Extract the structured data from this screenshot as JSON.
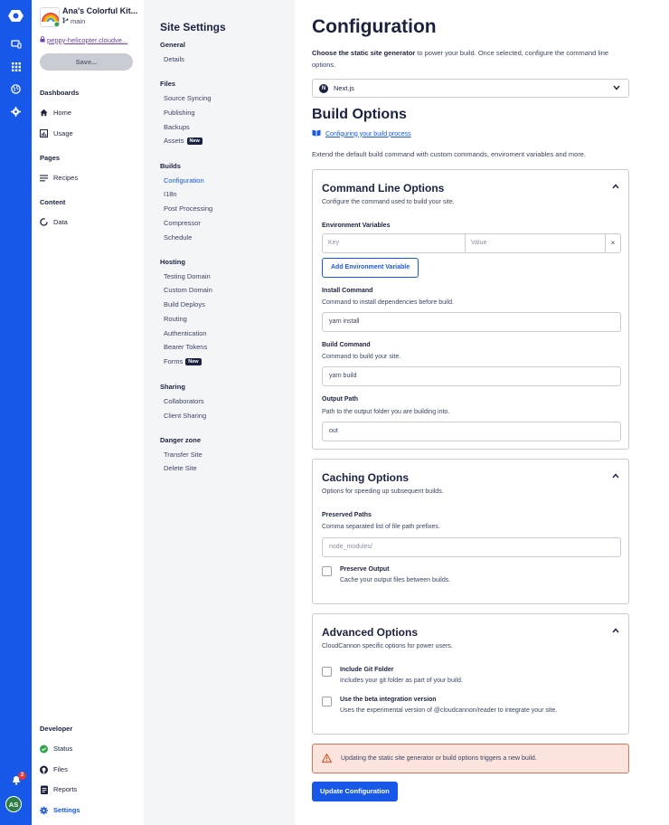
{
  "site": {
    "name": "Ana's Colorful Kit...",
    "branch": "main",
    "url": "peppy-helicopter.cloudve...",
    "save_label": "Save..."
  },
  "rail": {
    "notifications_count": "2",
    "avatar_initials": "AS"
  },
  "nav": {
    "dashboards_heading": "Dashboards",
    "home": "Home",
    "usage": "Usage",
    "pages_heading": "Pages",
    "recipes": "Recipes",
    "content_heading": "Content",
    "data": "Data",
    "developer_heading": "Developer",
    "status": "Status",
    "files": "Files",
    "reports": "Reports",
    "settings": "Settings"
  },
  "settings_nav": {
    "title": "Site Settings",
    "groups": [
      {
        "heading": "General",
        "items": [
          "Details"
        ]
      },
      {
        "heading": "Files",
        "items": [
          "Source Syncing",
          "Publishing",
          "Backups",
          "Assets"
        ]
      },
      {
        "heading": "Builds",
        "items": [
          "Configuration",
          "I18n",
          "Post Processing",
          "Compressor",
          "Schedule"
        ]
      },
      {
        "heading": "Hosting",
        "items": [
          "Testing Domain",
          "Custom Domain",
          "Build Deploys",
          "Routing",
          "Authentication",
          "Bearer Tokens",
          "Forms"
        ]
      },
      {
        "heading": "Sharing",
        "items": [
          "Collaborators",
          "Client Sharing"
        ]
      },
      {
        "heading": "Danger zone",
        "items": [
          "Transfer Site",
          "Delete Site"
        ]
      }
    ],
    "new_badge": "New"
  },
  "main": {
    "title": "Configuration",
    "intro_bold": "Choose the static site generator",
    "intro_rest": " to power your build. Once selected, configure the command line options.",
    "ssg_selected": "Next.js",
    "build_options_title": "Build Options",
    "build_options_link": "Configuring your build process",
    "build_options_desc": "Extend the default build command with custom commands, enviroment variables and more."
  },
  "command_line": {
    "title": "Command Line Options",
    "subtitle": "Configure the command used to build your site.",
    "env_label": "Environment Variables",
    "key_placeholder": "Key",
    "value_placeholder": "Value",
    "remove_symbol": "×",
    "add_env_label": "Add Environment Variable",
    "install_label": "Install Command",
    "install_hint": "Command to install dependencies before build.",
    "install_value": "yarn install",
    "build_label": "Build Command",
    "build_hint": "Command to build your site.",
    "build_value": "yarn build",
    "output_label": "Output Path",
    "output_hint": "Path to the output folder you are building into.",
    "output_value": "out"
  },
  "caching": {
    "title": "Caching Options",
    "subtitle": "Options for speeding up subsequent builds.",
    "preserved_label": "Preserved Paths",
    "preserved_hint": "Comma separated list of file path prefixes.",
    "preserved_placeholder": "node_modules/",
    "preserve_output_label": "Preserve Output",
    "preserve_output_desc": "Cache your output files between builds."
  },
  "advanced": {
    "title": "Advanced Options",
    "subtitle": "CloudCannon specific options for power users.",
    "git_label": "Include Git Folder",
    "git_desc": "Includes your git folder as part of your build.",
    "beta_label": "Use the beta integration version",
    "beta_desc": "Uses the experimental version of @cloudcannon/reader to integrate your site."
  },
  "warning_text": "Updating the static site generator or build options triggers a new build.",
  "update_button": "Update Configuration",
  "colors": {
    "primary": "#1858e8",
    "rail": "#1858e8",
    "warning_bg": "#fbe4dd",
    "warning_border": "#e0734f"
  }
}
